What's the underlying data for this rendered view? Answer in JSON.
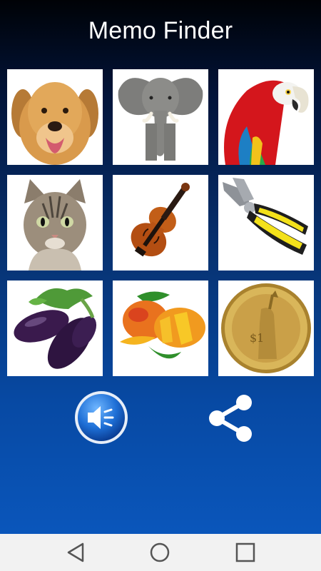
{
  "app": {
    "title": "Memo Finder"
  },
  "cards": [
    {
      "icon": "dog-icon"
    },
    {
      "icon": "elephant-icon"
    },
    {
      "icon": "parrot-icon"
    },
    {
      "icon": "cat-icon"
    },
    {
      "icon": "violin-icon"
    },
    {
      "icon": "pliers-icon"
    },
    {
      "icon": "eggplant-icon"
    },
    {
      "icon": "mango-icon"
    },
    {
      "icon": "coin-icon"
    }
  ],
  "controls": {
    "sound_icon": "speaker-icon",
    "share_icon": "share-icon"
  },
  "navbar": {
    "back_icon": "back-triangle-icon",
    "home_icon": "home-circle-icon",
    "recent_icon": "recent-square-icon"
  },
  "colors": {
    "accent": "#0a56bb",
    "header_dark": "#000206",
    "card_bg": "#ffffff",
    "navbar_bg": "#f2f2f2"
  }
}
